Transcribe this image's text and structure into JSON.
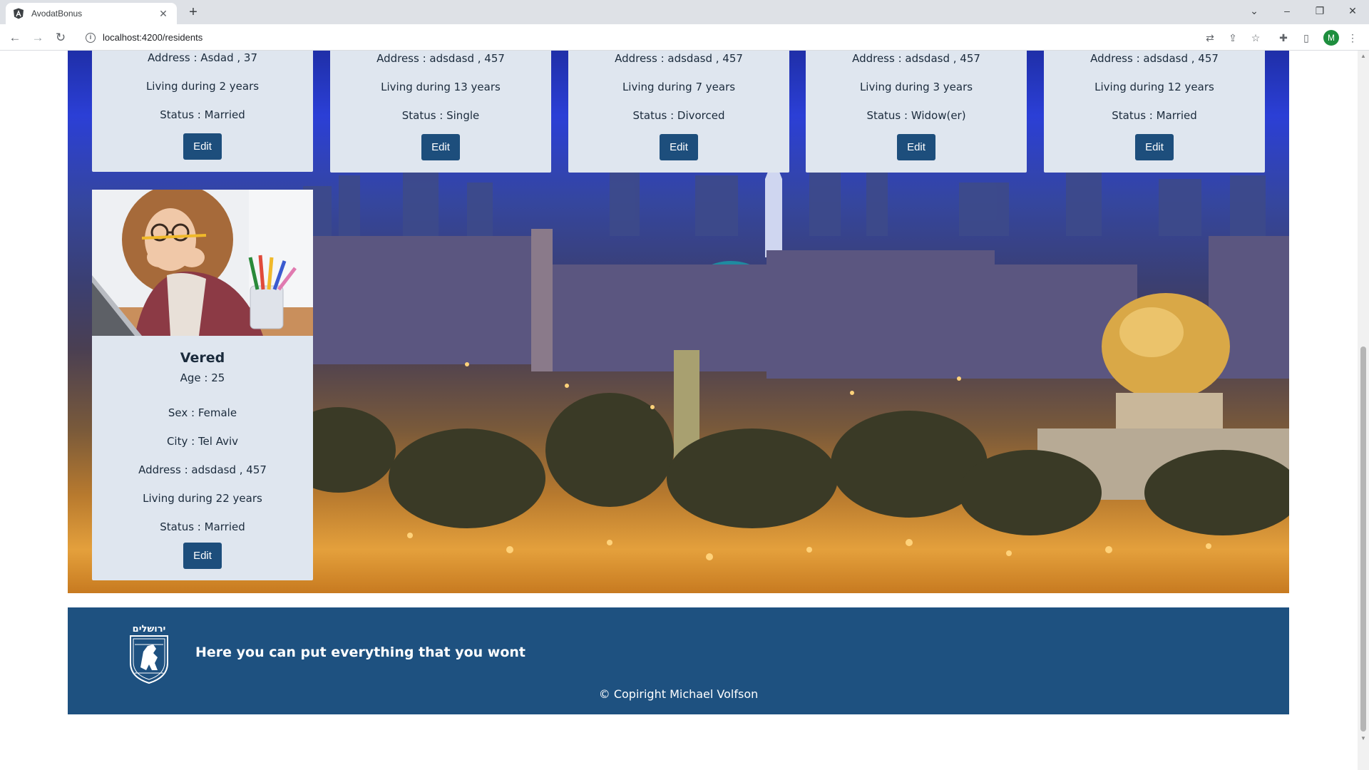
{
  "browser": {
    "tab_title": "AvodatBonus",
    "url": "localhost:4200/residents",
    "profile_initial": "M"
  },
  "cards_top": [
    {
      "address": "Address : Asdad , 37",
      "living": "Living during 2 years",
      "status": "Status : Married",
      "edit_label": "Edit"
    },
    {
      "address": "Address : adsdasd , 457",
      "living": "Living during 13 years",
      "status": "Status : Single",
      "edit_label": "Edit"
    },
    {
      "address": "Address : adsdasd , 457",
      "living": "Living during 7 years",
      "status": "Status : Divorced",
      "edit_label": "Edit"
    },
    {
      "address": "Address : adsdasd , 457",
      "living": "Living during 3 years",
      "status": "Status : Widow(er)",
      "edit_label": "Edit"
    },
    {
      "address": "Address : adsdasd , 457",
      "living": "Living during 12 years",
      "status": "Status : Married",
      "edit_label": "Edit"
    }
  ],
  "card_full": {
    "name": "Vered",
    "age": "Age : 25",
    "sex": "Sex : Female",
    "city": "City : Tel Aviv",
    "address": "Address : adsdasd , 457",
    "living": "Living during 22 years",
    "status": "Status : Married",
    "edit_label": "Edit"
  },
  "footer": {
    "logo_text": "ירושלים",
    "text": "Here you can put everything that you wont",
    "copyright": "© Copiright Michael Volfson"
  },
  "colors": {
    "card_bg": "#dfe6ef",
    "button": "#1d4e7c",
    "footer": "#1e5180"
  }
}
